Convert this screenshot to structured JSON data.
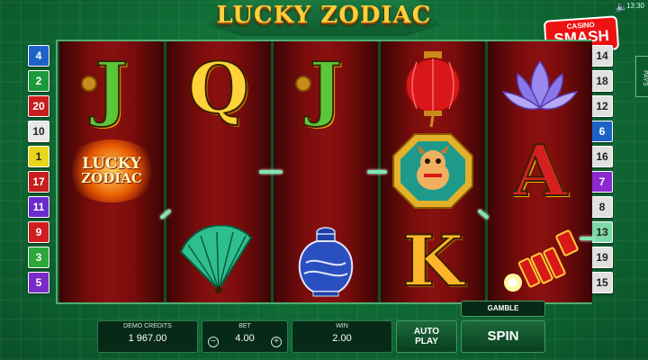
{
  "game": {
    "title": "LUCKY ZODIAC",
    "pays_label": "PAYS",
    "clock": "13:30",
    "logo": {
      "line1": "CASINO",
      "line2": "SMASH"
    }
  },
  "colors": {
    "background": "#0f6a34",
    "reel": "#7a0c0c",
    "panel": "#062a17",
    "accent_gold": "#ffcf3a"
  },
  "paylines": {
    "left": [
      {
        "n": "4",
        "color": "#1e62c8"
      },
      {
        "n": "2",
        "color": "#1a9a3a"
      },
      {
        "n": "20",
        "color": "#c81e1e"
      },
      {
        "n": "10",
        "color": "#e8e8e8"
      },
      {
        "n": "1",
        "color": "#e8d61a"
      },
      {
        "n": "17",
        "color": "#c81e1e"
      },
      {
        "n": "11",
        "color": "#6a2ad0"
      },
      {
        "n": "9",
        "color": "#d01e1e"
      },
      {
        "n": "3",
        "color": "#2aa83a"
      },
      {
        "n": "5",
        "color": "#7a2ac8"
      }
    ],
    "right": [
      {
        "n": "14",
        "color": "#e0e0e0"
      },
      {
        "n": "18",
        "color": "#e0e0e0"
      },
      {
        "n": "12",
        "color": "#e0e0e0"
      },
      {
        "n": "6",
        "color": "#1e62c8"
      },
      {
        "n": "16",
        "color": "#e0e0e0"
      },
      {
        "n": "7",
        "color": "#8a2ad0"
      },
      {
        "n": "8",
        "color": "#e0e0e0"
      },
      {
        "n": "13",
        "color": "#7fd8a8"
      },
      {
        "n": "19",
        "color": "#e0e0e0"
      },
      {
        "n": "15",
        "color": "#e0e0e0"
      }
    ]
  },
  "reels": [
    {
      "symbols": [
        "J",
        "LUCKY ZODIAC",
        ""
      ]
    },
    {
      "symbols": [
        "Q",
        "",
        "fan"
      ]
    },
    {
      "symbols": [
        "J",
        "",
        "vase"
      ]
    },
    {
      "symbols": [
        "lantern",
        "dog",
        "K"
      ]
    },
    {
      "symbols": [
        "lotus",
        "A",
        "firecrackers"
      ]
    }
  ],
  "wild": {
    "line1": "LUCKY",
    "line2": "ZODIAC"
  },
  "controls": {
    "demo_credits_label": "DEMO CREDITS",
    "demo_credits_value": "1 967.00",
    "bet_label": "BET",
    "bet_value": "4.00",
    "win_label": "WIN",
    "win_value": "2.00",
    "autoplay_line1": "AUTO",
    "autoplay_line2": "PLAY",
    "gamble_label": "GAMBLE",
    "spin_label": "SPIN",
    "minus": "−",
    "plus": "+"
  }
}
